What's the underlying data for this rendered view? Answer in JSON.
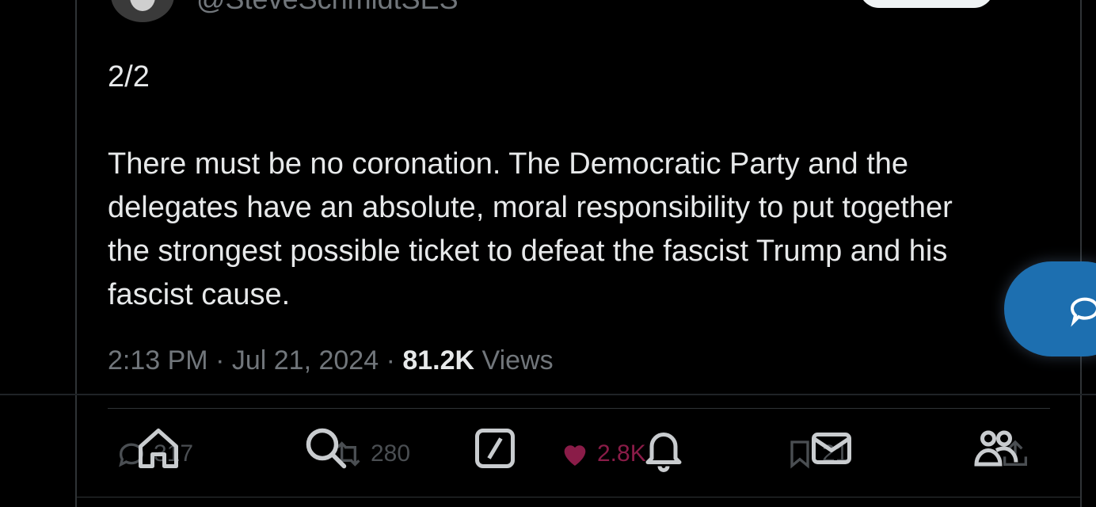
{
  "tweet": {
    "handle": "@SteveSchmidtSES",
    "text": "2/2\n\nThere must be no coronation. The Democratic Party and the\ndelegates have an absolute, moral responsibility to put together\nthe strongest possible ticket to defeat the fascist Trump and his\nfascist cause.",
    "time": "2:13 PM",
    "date": "Jul 21, 2024",
    "views_count": "81.2K",
    "views_label": "Views"
  },
  "actions": {
    "replies": "317",
    "reposts": "280",
    "likes": "2.8K",
    "bookmarks": "21"
  },
  "colors": {
    "background": "#000000",
    "text": "#e7e9ea",
    "secondary": "#71767b",
    "like": "#8a1c48",
    "fab": "#1d6fb0"
  },
  "icons": {
    "reply": "reply-icon",
    "repost": "repost-icon",
    "like": "heart-icon",
    "bookmark": "bookmark-icon",
    "share": "share-icon",
    "home": "home-icon",
    "search": "search-icon",
    "grok": "grok-icon",
    "notifications": "bell-icon",
    "messages": "mail-icon",
    "communities": "communities-icon",
    "compose": "compose-icon"
  }
}
